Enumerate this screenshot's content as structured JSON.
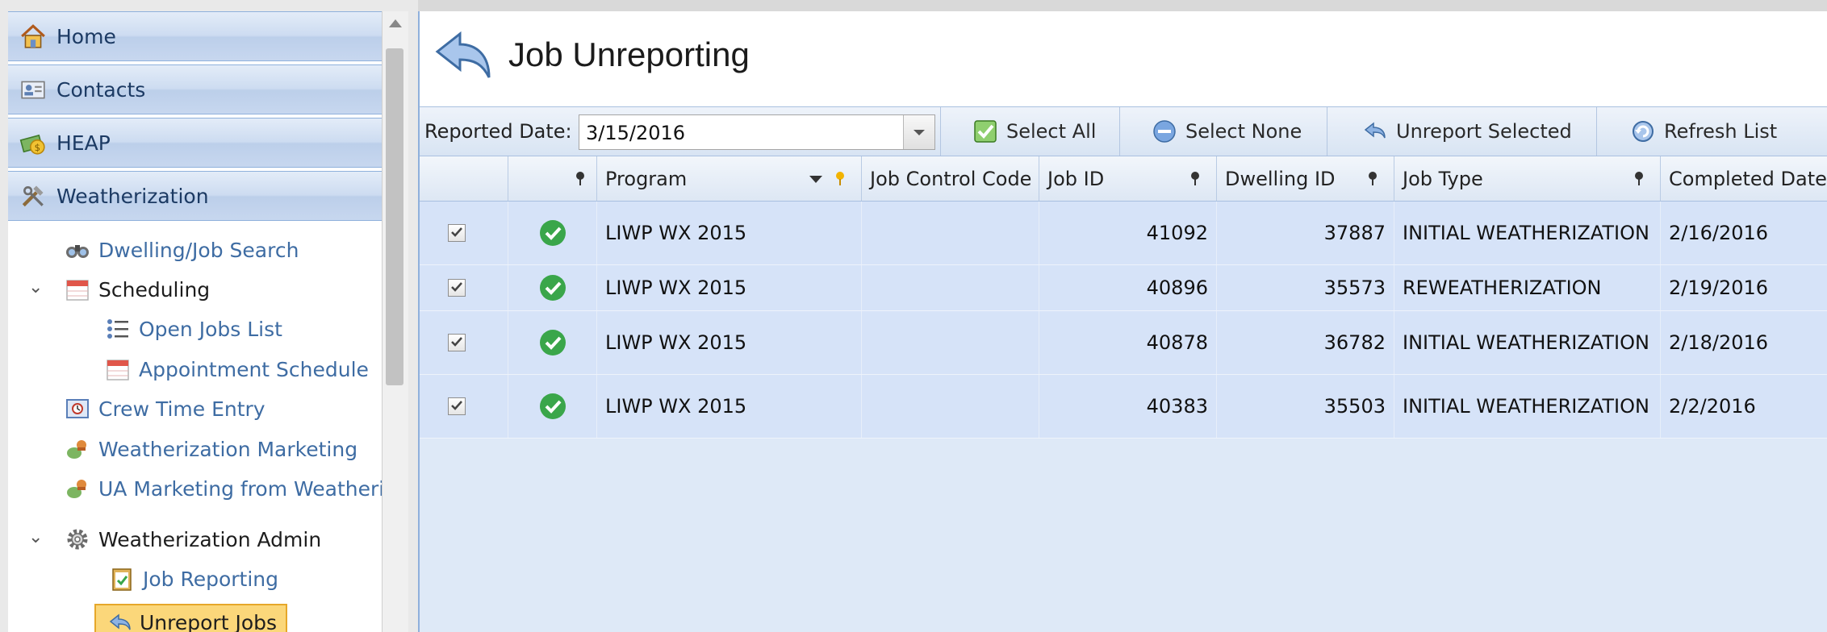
{
  "sidebar": {
    "headers": [
      {
        "label": "Home",
        "icon": "home-icon"
      },
      {
        "label": "Contacts",
        "icon": "contacts-card-icon"
      },
      {
        "label": "HEAP",
        "icon": "money-icon"
      },
      {
        "label": "Weatherization",
        "icon": "tools-icon"
      }
    ],
    "items": [
      {
        "label": "Dwelling/Job Search",
        "icon": "binoculars-icon"
      },
      {
        "label": "Scheduling",
        "icon": "calendar-icon"
      },
      {
        "label": "Open Jobs List",
        "icon": "list-icon"
      },
      {
        "label": "Appointment Schedule",
        "icon": "calendar-icon"
      },
      {
        "label": "Crew Time Entry",
        "icon": "time-entry-icon"
      },
      {
        "label": "Weatherization Marketing",
        "icon": "marketing-icon"
      },
      {
        "label": "UA Marketing from Weatheriz",
        "icon": "marketing-icon"
      },
      {
        "label": "Weatherization Admin",
        "icon": "gear-icon"
      },
      {
        "label": "Job Reporting",
        "icon": "clipboard-check-icon"
      },
      {
        "label": "Unreport Jobs",
        "icon": "unreport-arrow-icon",
        "selected": true
      }
    ]
  },
  "page": {
    "title": "Job Unreporting",
    "title_icon": "unreport-arrow-icon"
  },
  "toolbar": {
    "date_label": "Reported Date:",
    "date_value": "3/15/2016",
    "select_all": "Select All",
    "select_none": "Select None",
    "unreport_selected": "Unreport Selected",
    "refresh_list": "Refresh List"
  },
  "grid": {
    "columns": [
      "",
      "",
      "Program",
      "Job Control Code",
      "Job ID",
      "Dwelling ID",
      "Job Type",
      "Completed Date"
    ],
    "rows": [
      {
        "checked": true,
        "status": "complete",
        "program": "LIWP WX 2015",
        "job_control_code": "",
        "job_id": "41092",
        "dwelling_id": "37887",
        "job_type": "INITIAL WEATHERIZATION",
        "completed_date": "2/16/2016"
      },
      {
        "checked": true,
        "status": "complete",
        "program": "LIWP WX 2015",
        "job_control_code": "",
        "job_id": "40896",
        "dwelling_id": "35573",
        "job_type": "REWEATHERIZATION",
        "completed_date": "2/19/2016"
      },
      {
        "checked": true,
        "status": "complete",
        "program": "LIWP WX 2015",
        "job_control_code": "",
        "job_id": "40878",
        "dwelling_id": "36782",
        "job_type": "INITIAL WEATHERIZATION",
        "completed_date": "2/18/2016"
      },
      {
        "checked": true,
        "status": "complete",
        "program": "LIWP WX 2015",
        "job_control_code": "",
        "job_id": "40383",
        "dwelling_id": "35503",
        "job_type": "INITIAL WEATHERIZATION",
        "completed_date": "2/2/2016"
      }
    ]
  },
  "colors": {
    "accent_blue": "#3e6ca3",
    "selected_bg": "#fbd77a",
    "row_bg": "#d6e3f8",
    "status_green": "#3aa64a"
  }
}
